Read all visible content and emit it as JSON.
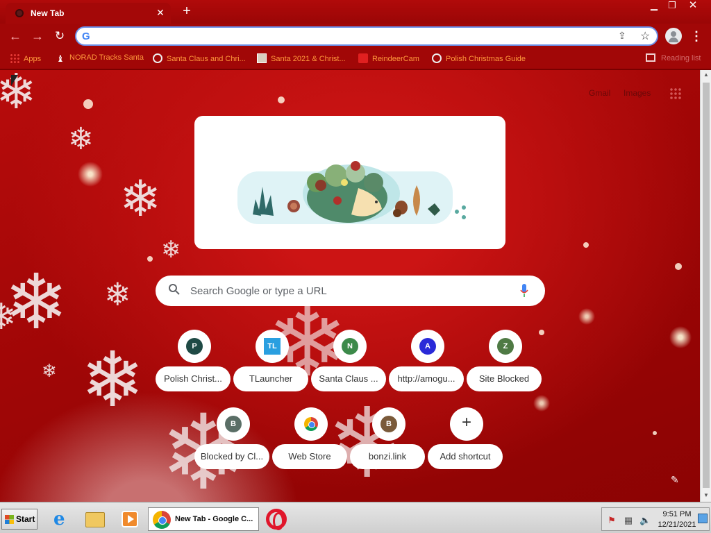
{
  "browser": {
    "tab": {
      "title": "New Tab",
      "close": "✕"
    },
    "new_tab_symbol": "+",
    "window_controls": {
      "minimize": "▁",
      "maximize": "❐",
      "close": "✕"
    },
    "nav": {
      "back": "←",
      "forward": "→",
      "reload": "↻"
    },
    "omnibox": {
      "value": "",
      "placeholder": "",
      "share_icon": "⇪",
      "star_icon": "☆",
      "google_g": "G"
    },
    "menu": "⋮",
    "bookmarks": [
      {
        "label": "Apps",
        "icon": "apps-grid-icon"
      },
      {
        "label": "NORAD Tracks Santa",
        "icon": "norad-icon"
      },
      {
        "label": "Santa Claus and Chri...",
        "icon": "globe-icon"
      },
      {
        "label": "Santa 2021 & Christ...",
        "icon": "thumbnail-icon"
      },
      {
        "label": "ReindeerCam",
        "icon": "reindeer-icon"
      },
      {
        "label": "Polish Christmas Guide",
        "icon": "globe-icon"
      }
    ],
    "reading_list": "Reading list"
  },
  "ntp": {
    "top_links": {
      "gmail": "Gmail",
      "images": "Images"
    },
    "search": {
      "placeholder": "Search Google or type a URL"
    },
    "shortcuts": [
      {
        "label": "Polish Christ...",
        "letter": "P",
        "color": "#1f4a45"
      },
      {
        "label": "TLauncher",
        "letter": "TL",
        "color": "#2a9fe0"
      },
      {
        "label": "Santa Claus ...",
        "letter": "N",
        "color": "#3c8a4a"
      },
      {
        "label": "http://amogu...",
        "letter": "A",
        "color": "#2a2ad8"
      },
      {
        "label": "Site Blocked",
        "letter": "Z",
        "color": "#4f7a44"
      },
      {
        "label": "Blocked by Cl...",
        "letter": "B",
        "color": "#5a6e66"
      },
      {
        "label": "Web Store",
        "letter": "",
        "color": ""
      },
      {
        "label": "bonzi.link",
        "letter": "B",
        "color": "#7a5a3a"
      },
      {
        "label": "Add shortcut",
        "letter": "+",
        "color": ""
      }
    ],
    "customize_icon": "✎"
  },
  "taskbar": {
    "start": "Start",
    "active_task": "New Tab - Google C...",
    "clock": {
      "time": "9:51 PM",
      "date": "12/21/2021"
    }
  },
  "colors": {
    "theme_red": "#a10707",
    "bookmark_text": "#ff9a3c",
    "omnibox_border": "#6b8fe8"
  }
}
